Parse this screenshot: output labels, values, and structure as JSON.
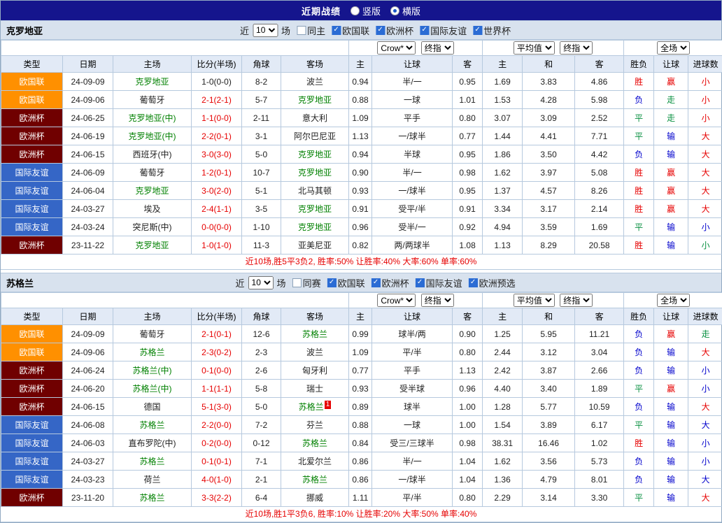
{
  "topbar": {
    "title": "近期战绩",
    "radios": [
      {
        "label": "竖版",
        "selected": false
      },
      {
        "label": "横版",
        "selected": true
      }
    ]
  },
  "colors": {
    "topbar_navy": "#15158d",
    "type_orange": "#ff9000",
    "type_maroon": "#700000",
    "type_blue": "#3566c6",
    "win_red": "#e60000",
    "loss_blue": "#0000cc",
    "draw_green": "#089040",
    "team_green": "#008000",
    "summary_red": "#e60000"
  },
  "sections": [
    {
      "team": "克罗地亚",
      "filter": {
        "near_label": "近",
        "count": "10",
        "games_label": "场",
        "same_label": "同主",
        "same_checked": false,
        "competitions": [
          {
            "label": "欧国联",
            "checked": true
          },
          {
            "label": "欧洲杯",
            "checked": true
          },
          {
            "label": "国际友谊",
            "checked": true
          },
          {
            "label": "世界杯",
            "checked": true
          }
        ]
      },
      "dropdowns": {
        "source": "Crow*",
        "source_time": "终指",
        "average": "平均值",
        "average_time": "终指",
        "scope": "全场"
      },
      "headers": [
        "类型",
        "日期",
        "主场",
        "比分(半场)",
        "角球",
        "客场",
        "主",
        "让球",
        "客",
        "主",
        "和",
        "客",
        "胜负",
        "让球",
        "进球数"
      ],
      "rows": [
        {
          "type": "欧国联",
          "type_color": "orange",
          "date": "24-09-09",
          "home": "克罗地亚",
          "home_color": "green",
          "score": "1-0(0-0)",
          "score_color": "black",
          "corner": "8-2",
          "away": "波兰",
          "away_color": "black",
          "odds_home": "0.94",
          "handicap": "半/一",
          "odds_away": "0.95",
          "avg_home": "1.69",
          "avg_draw": "3.83",
          "avg_away": "4.86",
          "result": "胜",
          "result_color": "red",
          "handicap_result": "赢",
          "handicap_result_color": "red",
          "goals": "小",
          "goals_color": "red"
        },
        {
          "type": "欧国联",
          "type_color": "orange",
          "date": "24-09-06",
          "home": "葡萄牙",
          "home_color": "black",
          "score": "2-1(2-1)",
          "score_color": "red",
          "corner": "5-7",
          "away": "克罗地亚",
          "away_color": "green",
          "odds_home": "0.88",
          "handicap": "一球",
          "odds_away": "1.01",
          "avg_home": "1.53",
          "avg_draw": "4.28",
          "avg_away": "5.98",
          "result": "负",
          "result_color": "blue",
          "handicap_result": "走",
          "handicap_result_color": "green",
          "goals": "小",
          "goals_color": "red"
        },
        {
          "type": "欧洲杯",
          "type_color": "maroon",
          "date": "24-06-25",
          "home": "克罗地亚(中)",
          "home_color": "green",
          "score": "1-1(0-0)",
          "score_color": "red",
          "corner": "2-11",
          "away": "意大利",
          "away_color": "black",
          "odds_home": "1.09",
          "handicap": "平手",
          "odds_away": "0.80",
          "avg_home": "3.07",
          "avg_draw": "3.09",
          "avg_away": "2.52",
          "result": "平",
          "result_color": "green",
          "handicap_result": "走",
          "handicap_result_color": "green",
          "goals": "小",
          "goals_color": "red"
        },
        {
          "type": "欧洲杯",
          "type_color": "maroon",
          "date": "24-06-19",
          "home": "克罗地亚(中)",
          "home_color": "green",
          "score": "2-2(0-1)",
          "score_color": "red",
          "corner": "3-1",
          "away": "阿尔巴尼亚",
          "away_color": "black",
          "odds_home": "1.13",
          "handicap": "一/球半",
          "odds_away": "0.77",
          "avg_home": "1.44",
          "avg_draw": "4.41",
          "avg_away": "7.71",
          "result": "平",
          "result_color": "green",
          "handicap_result": "输",
          "handicap_result_color": "blue",
          "goals": "大",
          "goals_color": "red"
        },
        {
          "type": "欧洲杯",
          "type_color": "maroon",
          "date": "24-06-15",
          "home": "西班牙(中)",
          "home_color": "black",
          "score": "3-0(3-0)",
          "score_color": "red",
          "corner": "5-0",
          "away": "克罗地亚",
          "away_color": "green",
          "odds_home": "0.94",
          "handicap": "半球",
          "odds_away": "0.95",
          "avg_home": "1.86",
          "avg_draw": "3.50",
          "avg_away": "4.42",
          "result": "负",
          "result_color": "blue",
          "handicap_result": "输",
          "handicap_result_color": "blue",
          "goals": "大",
          "goals_color": "red"
        },
        {
          "type": "国际友谊",
          "type_color": "blue",
          "date": "24-06-09",
          "home": "葡萄牙",
          "home_color": "black",
          "score": "1-2(0-1)",
          "score_color": "red",
          "corner": "10-7",
          "away": "克罗地亚",
          "away_color": "green",
          "odds_home": "0.90",
          "handicap": "半/一",
          "odds_away": "0.98",
          "avg_home": "1.62",
          "avg_draw": "3.97",
          "avg_away": "5.08",
          "result": "胜",
          "result_color": "red",
          "handicap_result": "赢",
          "handicap_result_color": "red",
          "goals": "大",
          "goals_color": "red"
        },
        {
          "type": "国际友谊",
          "type_color": "blue",
          "date": "24-06-04",
          "home": "克罗地亚",
          "home_color": "green",
          "score": "3-0(2-0)",
          "score_color": "red",
          "corner": "5-1",
          "away": "北马其顿",
          "away_color": "black",
          "odds_home": "0.93",
          "handicap": "一/球半",
          "odds_away": "0.95",
          "avg_home": "1.37",
          "avg_draw": "4.57",
          "avg_away": "8.26",
          "result": "胜",
          "result_color": "red",
          "handicap_result": "赢",
          "handicap_result_color": "red",
          "goals": "大",
          "goals_color": "red"
        },
        {
          "type": "国际友谊",
          "type_color": "blue",
          "date": "24-03-27",
          "home": "埃及",
          "home_color": "black",
          "score": "2-4(1-1)",
          "score_color": "red",
          "corner": "3-5",
          "away": "克罗地亚",
          "away_color": "green",
          "odds_home": "0.91",
          "handicap": "受平/半",
          "odds_away": "0.91",
          "avg_home": "3.34",
          "avg_draw": "3.17",
          "avg_away": "2.14",
          "result": "胜",
          "result_color": "red",
          "handicap_result": "赢",
          "handicap_result_color": "red",
          "goals": "大",
          "goals_color": "red"
        },
        {
          "type": "国际友谊",
          "type_color": "blue",
          "date": "24-03-24",
          "home": "突尼斯(中)",
          "home_color": "black",
          "score": "0-0(0-0)",
          "score_color": "red",
          "corner": "1-10",
          "away": "克罗地亚",
          "away_color": "green",
          "odds_home": "0.96",
          "handicap": "受半/一",
          "odds_away": "0.92",
          "avg_home": "4.94",
          "avg_draw": "3.59",
          "avg_away": "1.69",
          "result": "平",
          "result_color": "green",
          "handicap_result": "输",
          "handicap_result_color": "blue",
          "goals": "小",
          "goals_color": "blue"
        },
        {
          "type": "欧洲杯",
          "type_color": "maroon",
          "date": "23-11-22",
          "home": "克罗地亚",
          "home_color": "green",
          "score": "1-0(1-0)",
          "score_color": "red",
          "corner": "11-3",
          "away": "亚美尼亚",
          "away_color": "black",
          "odds_home": "0.82",
          "handicap": "两/两球半",
          "odds_away": "1.08",
          "avg_home": "1.13",
          "avg_draw": "8.29",
          "avg_away": "20.58",
          "result": "胜",
          "result_color": "red",
          "handicap_result": "输",
          "handicap_result_color": "blue",
          "goals": "小",
          "goals_color": "green"
        }
      ],
      "summary": "近10场,胜5平3负2, 胜率:50% 让胜率:40% 大率:60% 单率:60%"
    },
    {
      "team": "苏格兰",
      "filter": {
        "near_label": "近",
        "count": "10",
        "games_label": "场",
        "same_label": "同赛",
        "same_checked": false,
        "competitions": [
          {
            "label": "欧国联",
            "checked": true
          },
          {
            "label": "欧洲杯",
            "checked": true
          },
          {
            "label": "国际友谊",
            "checked": true
          },
          {
            "label": "欧洲预选",
            "checked": true
          }
        ]
      },
      "dropdowns": {
        "source": "Crow*",
        "source_time": "终指",
        "average": "平均值",
        "average_time": "终指",
        "scope": "全场"
      },
      "headers": [
        "类型",
        "日期",
        "主场",
        "比分(半场)",
        "角球",
        "客场",
        "主",
        "让球",
        "客",
        "主",
        "和",
        "客",
        "胜负",
        "让球",
        "进球数"
      ],
      "rows": [
        {
          "type": "欧国联",
          "type_color": "orange",
          "date": "24-09-09",
          "home": "葡萄牙",
          "home_color": "black",
          "score": "2-1(0-1)",
          "score_color": "red",
          "corner": "12-6",
          "away": "苏格兰",
          "away_color": "green",
          "odds_home": "0.99",
          "handicap": "球半/两",
          "odds_away": "0.90",
          "avg_home": "1.25",
          "avg_draw": "5.95",
          "avg_away": "11.21",
          "result": "负",
          "result_color": "blue",
          "handicap_result": "赢",
          "handicap_result_color": "red",
          "goals": "走",
          "goals_color": "green"
        },
        {
          "type": "欧国联",
          "type_color": "orange",
          "date": "24-09-06",
          "home": "苏格兰",
          "home_color": "green",
          "score": "2-3(0-2)",
          "score_color": "red",
          "corner": "2-3",
          "away": "波兰",
          "away_color": "black",
          "odds_home": "1.09",
          "handicap": "平/半",
          "odds_away": "0.80",
          "avg_home": "2.44",
          "avg_draw": "3.12",
          "avg_away": "3.04",
          "result": "负",
          "result_color": "blue",
          "handicap_result": "输",
          "handicap_result_color": "blue",
          "goals": "大",
          "goals_color": "red"
        },
        {
          "type": "欧洲杯",
          "type_color": "maroon",
          "date": "24-06-24",
          "home": "苏格兰(中)",
          "home_color": "green",
          "score": "0-1(0-0)",
          "score_color": "red",
          "corner": "2-6",
          "away": "匈牙利",
          "away_color": "black",
          "odds_home": "0.77",
          "handicap": "平手",
          "odds_away": "1.13",
          "avg_home": "2.42",
          "avg_draw": "3.87",
          "avg_away": "2.66",
          "result": "负",
          "result_color": "blue",
          "handicap_result": "输",
          "handicap_result_color": "blue",
          "goals": "小",
          "goals_color": "blue"
        },
        {
          "type": "欧洲杯",
          "type_color": "maroon",
          "date": "24-06-20",
          "home": "苏格兰(中)",
          "home_color": "green",
          "score": "1-1(1-1)",
          "score_color": "red",
          "corner": "5-8",
          "away": "瑞士",
          "away_color": "black",
          "odds_home": "0.93",
          "handicap": "受半球",
          "odds_away": "0.96",
          "avg_home": "4.40",
          "avg_draw": "3.40",
          "avg_away": "1.89",
          "result": "平",
          "result_color": "green",
          "handicap_result": "赢",
          "handicap_result_color": "red",
          "goals": "小",
          "goals_color": "blue"
        },
        {
          "type": "欧洲杯",
          "type_color": "maroon",
          "date": "24-06-15",
          "home": "德国",
          "home_color": "black",
          "score": "5-1(3-0)",
          "score_color": "red",
          "corner": "5-0",
          "away": "苏格兰",
          "away_color": "green",
          "away_badge": "1",
          "odds_home": "0.89",
          "handicap": "球半",
          "odds_away": "1.00",
          "avg_home": "1.28",
          "avg_draw": "5.77",
          "avg_away": "10.59",
          "result": "负",
          "result_color": "blue",
          "handicap_result": "输",
          "handicap_result_color": "blue",
          "goals": "大",
          "goals_color": "red"
        },
        {
          "type": "国际友谊",
          "type_color": "blue",
          "date": "24-06-08",
          "home": "苏格兰",
          "home_color": "green",
          "score": "2-2(0-0)",
          "score_color": "red",
          "corner": "7-2",
          "away": "芬兰",
          "away_color": "black",
          "odds_home": "0.88",
          "handicap": "一球",
          "odds_away": "1.00",
          "avg_home": "1.54",
          "avg_draw": "3.89",
          "avg_away": "6.17",
          "result": "平",
          "result_color": "green",
          "handicap_result": "输",
          "handicap_result_color": "blue",
          "goals": "大",
          "goals_color": "blue"
        },
        {
          "type": "国际友谊",
          "type_color": "blue",
          "date": "24-06-03",
          "home": "直布罗陀(中)",
          "home_color": "black",
          "score": "0-2(0-0)",
          "score_color": "red",
          "corner": "0-12",
          "away": "苏格兰",
          "away_color": "green",
          "odds_home": "0.84",
          "handicap": "受三/三球半",
          "odds_away": "0.98",
          "avg_home": "38.31",
          "avg_draw": "16.46",
          "avg_away": "1.02",
          "result": "胜",
          "result_color": "red",
          "handicap_result": "输",
          "handicap_result_color": "blue",
          "goals": "小",
          "goals_color": "blue"
        },
        {
          "type": "国际友谊",
          "type_color": "blue",
          "date": "24-03-27",
          "home": "苏格兰",
          "home_color": "green",
          "score": "0-1(0-1)",
          "score_color": "red",
          "corner": "7-1",
          "away": "北爱尔兰",
          "away_color": "black",
          "odds_home": "0.86",
          "handicap": "半/一",
          "odds_away": "1.04",
          "avg_home": "1.62",
          "avg_draw": "3.56",
          "avg_away": "5.73",
          "result": "负",
          "result_color": "blue",
          "handicap_result": "输",
          "handicap_result_color": "blue",
          "goals": "小",
          "goals_color": "blue"
        },
        {
          "type": "国际友谊",
          "type_color": "blue",
          "date": "24-03-23",
          "home": "荷兰",
          "home_color": "black",
          "score": "4-0(1-0)",
          "score_color": "red",
          "corner": "2-1",
          "away": "苏格兰",
          "away_color": "green",
          "odds_home": "0.86",
          "handicap": "一/球半",
          "odds_away": "1.04",
          "avg_home": "1.36",
          "avg_draw": "4.79",
          "avg_away": "8.01",
          "result": "负",
          "result_color": "blue",
          "handicap_result": "输",
          "handicap_result_color": "blue",
          "goals": "大",
          "goals_color": "blue"
        },
        {
          "type": "欧洲杯",
          "type_color": "maroon",
          "date": "23-11-20",
          "home": "苏格兰",
          "home_color": "green",
          "score": "3-3(2-2)",
          "score_color": "red",
          "corner": "6-4",
          "away": "挪威",
          "away_color": "black",
          "odds_home": "1.11",
          "handicap": "平/半",
          "odds_away": "0.80",
          "avg_home": "2.29",
          "avg_draw": "3.14",
          "avg_away": "3.30",
          "result": "平",
          "result_color": "green",
          "handicap_result": "输",
          "handicap_result_color": "blue",
          "goals": "大",
          "goals_color": "red"
        }
      ],
      "summary": "近10场,胜1平3负6, 胜率:10% 让胜率:20% 大率:50% 单率:40%"
    }
  ]
}
